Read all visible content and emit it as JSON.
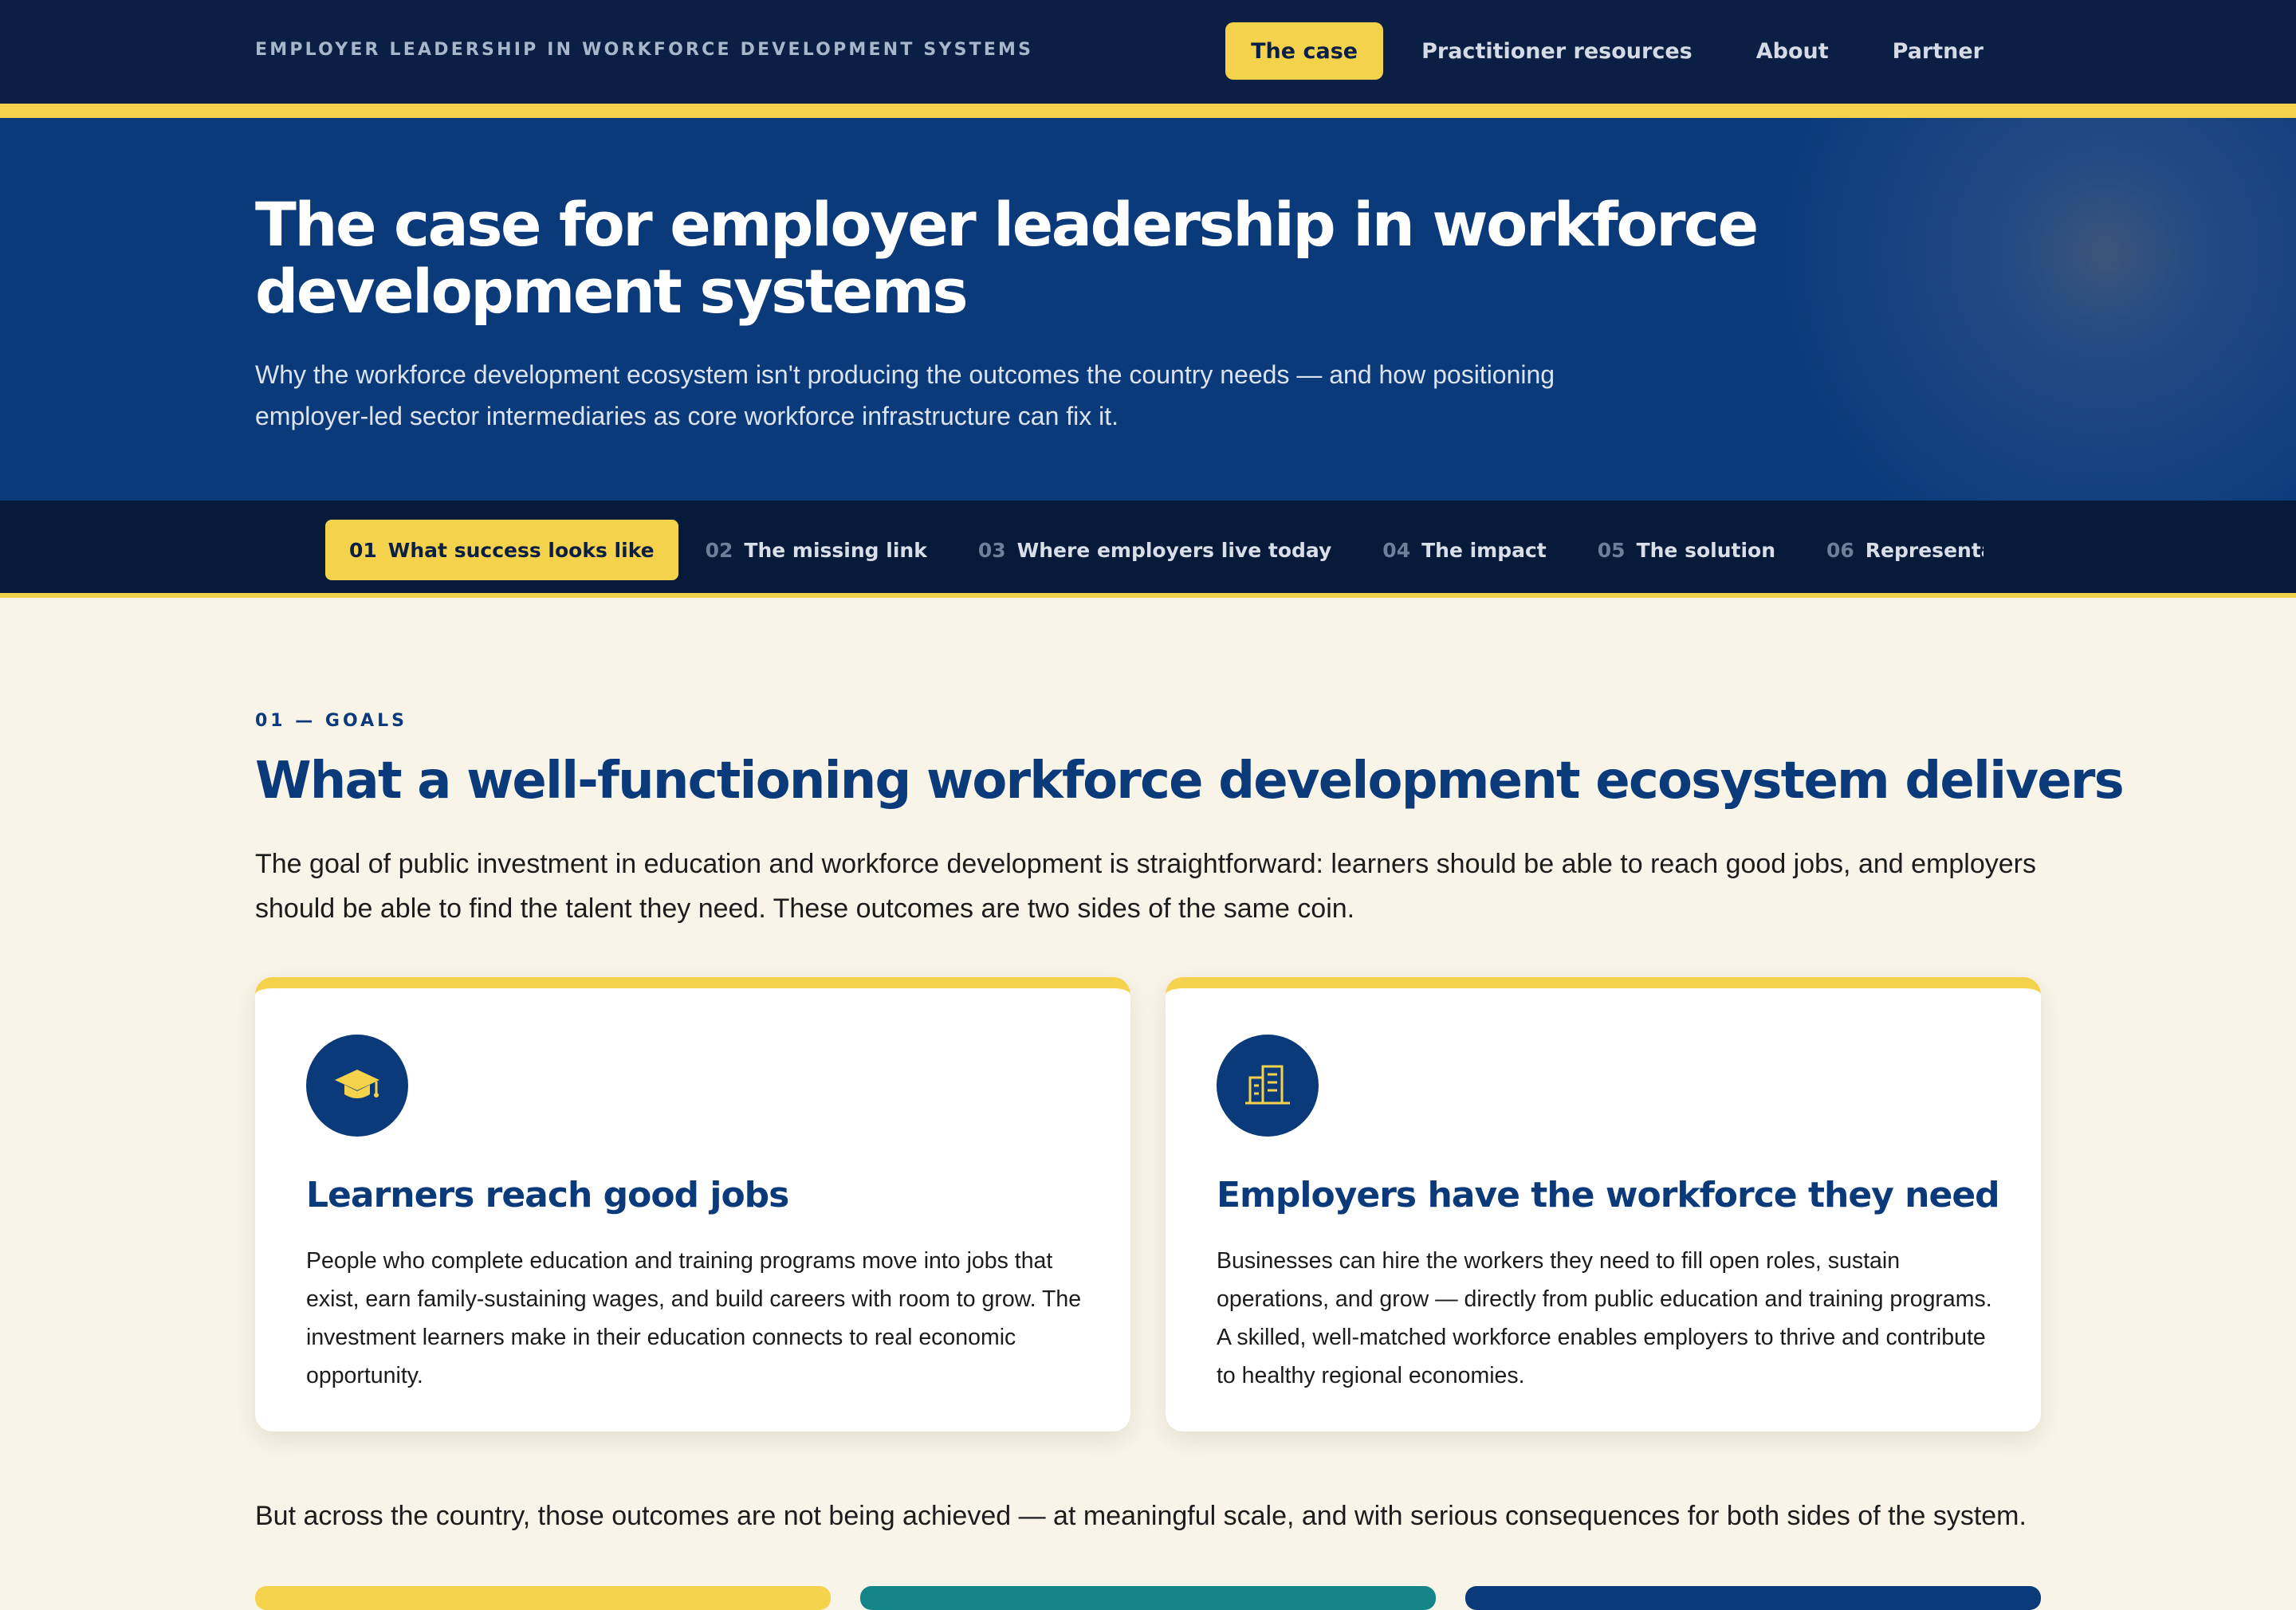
{
  "site": {
    "title": "EMPLOYER LEADERSHIP IN WORKFORCE DEVELOPMENT SYSTEMS"
  },
  "topnav": {
    "links": [
      {
        "label": "The case",
        "active": true
      },
      {
        "label": "Practitioner resources",
        "active": false
      },
      {
        "label": "About",
        "active": false
      },
      {
        "label": "Partner",
        "active": false
      }
    ]
  },
  "hero": {
    "title": "The case for employer leadership in workforce development systems",
    "subtitle": "Why the workforce development ecosystem isn't producing the outcomes the country needs — and how positioning employer-led sector intermediaries as core workforce infrastructure can fix it."
  },
  "section_nav": {
    "tabs": [
      {
        "num": "01",
        "label": "What success looks like",
        "active": true
      },
      {
        "num": "02",
        "label": "The missing link",
        "active": false
      },
      {
        "num": "03",
        "label": "Where employers live today",
        "active": false
      },
      {
        "num": "04",
        "label": "The impact",
        "active": false
      },
      {
        "num": "05",
        "label": "The solution",
        "active": false
      },
      {
        "num": "06",
        "label": "Representative voic",
        "active": false
      }
    ]
  },
  "section": {
    "eyebrow": "01 — GOALS",
    "title": "What a well-functioning workforce development ecosystem delivers",
    "intro": "The goal of public investment in education and workforce development is straightforward: learners should be able to reach good jobs, and employers should be able to find the talent they need. These outcomes are two sides of the same coin.",
    "cards": [
      {
        "icon": "graduation-cap-icon",
        "title": "Learners reach good jobs",
        "body": "People who complete education and training programs move into jobs that exist, earn family-sustaining wages, and build careers with room to grow. The investment learners make in their education connects to real economic opportunity."
      },
      {
        "icon": "building-icon",
        "title": "Employers have the workforce they need",
        "body": "Businesses can hire the workers they need to fill open roles, sustain operations, and grow — directly from public education and training programs. A skilled, well-matched workforce enables employers to thrive and contribute to healthy regional economies."
      }
    ],
    "closing": "But across the country, those outcomes are not being achieved — at meaningful scale, and with serious consequences for both sides of the system."
  },
  "colors": {
    "navy": "#0b1e44",
    "blue": "#0b3a7a",
    "yellow": "#f5d24b",
    "teal": "#138488",
    "cream": "#f8f4e8"
  }
}
